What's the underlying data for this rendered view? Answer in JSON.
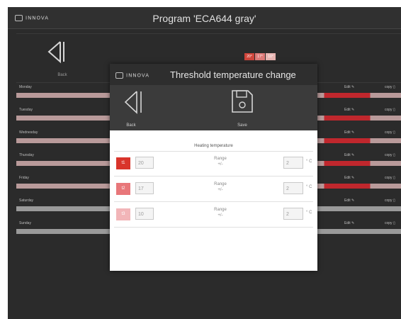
{
  "header": {
    "logo_text": "INNOVA",
    "program_title": "Program 'ECA644 gray'",
    "back_label": "Back",
    "temperature_badges": [
      {
        "label": "20°",
        "color": "#d0453b"
      },
      {
        "label": "17°",
        "color": "#de7a78"
      },
      {
        "label": "10°",
        "color": "#e8b5b2"
      }
    ]
  },
  "days": [
    {
      "label": "Monday",
      "edit": "Edit",
      "copy": "copy"
    },
    {
      "label": "Tuesday",
      "edit": "Edit",
      "copy": "copy"
    },
    {
      "label": "Wednesday",
      "edit": "Edit",
      "copy": "copy"
    },
    {
      "label": "Thursday",
      "edit": "Edit",
      "copy": "copy"
    },
    {
      "label": "Friday",
      "edit": "Edit",
      "copy": "copy"
    },
    {
      "label": "Saturday",
      "edit": "Edit",
      "copy": "copy"
    },
    {
      "label": "Sunday",
      "edit": "Edit",
      "copy": "copy"
    }
  ],
  "modal": {
    "logo_text": "INNOVA",
    "title": "Threshold temperature change",
    "back_label": "Back",
    "save_label": "Save",
    "section_title": "Heating temperature",
    "rows": [
      {
        "name": "t1",
        "value": "20",
        "range_label": "Range",
        "range_sign": "+/-",
        "range_value": "2",
        "unit": "° C",
        "color": "#d9342b"
      },
      {
        "name": "t2",
        "value": "17",
        "range_label": "Range",
        "range_sign": "+/-",
        "range_value": "2",
        "unit": "° C",
        "color": "#e8777a"
      },
      {
        "name": "t3",
        "value": "10",
        "range_label": "Range",
        "range_sign": "+/-",
        "range_value": "2",
        "unit": "° C",
        "color": "#f2b5b8"
      }
    ]
  },
  "colors": {
    "app_bg": "#2b2b2b",
    "bar_pink": "#b99a9a",
    "bar_red": "#c0272d",
    "bar_gray": "#9a9a9a"
  }
}
